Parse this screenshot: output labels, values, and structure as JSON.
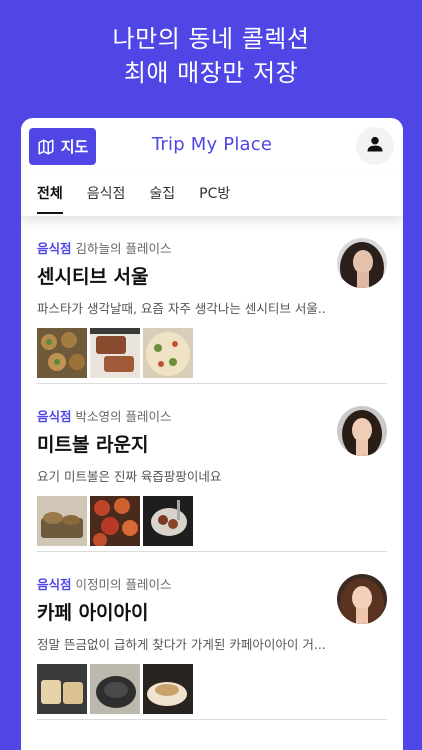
{
  "promo": {
    "line1": "나만의 동네 콜렉션",
    "line2": "최애 매장만 저장"
  },
  "header": {
    "map_label": "지도",
    "map_icon": "map-icon",
    "title": "Trip My Place",
    "profile_icon": "person-icon"
  },
  "tabs": [
    {
      "label": "전체",
      "active": true
    },
    {
      "label": "음식점",
      "active": false
    },
    {
      "label": "술집",
      "active": false
    },
    {
      "label": "PC방",
      "active": false
    }
  ],
  "colors": {
    "accent": "#4f46e5"
  },
  "feed": [
    {
      "category": "음식점",
      "owner": "김하늘의 플레이스",
      "title": "센시티브 서울",
      "description": "파스타가 생각날때, 요즘 자주 생각나는 센시티브 서울..."
    },
    {
      "category": "음식점",
      "owner": "박소영의 플레이스",
      "title": "미트볼 라운지",
      "description": "요기 미트볼은 진짜 육즙팡팡이네요"
    },
    {
      "category": "음식점",
      "owner": "이정미의 플레이스",
      "title": "카페 아이아이",
      "description": "정말 뜬금없이 급하게 찾다가 가게된 카페아이아이 거..."
    }
  ]
}
